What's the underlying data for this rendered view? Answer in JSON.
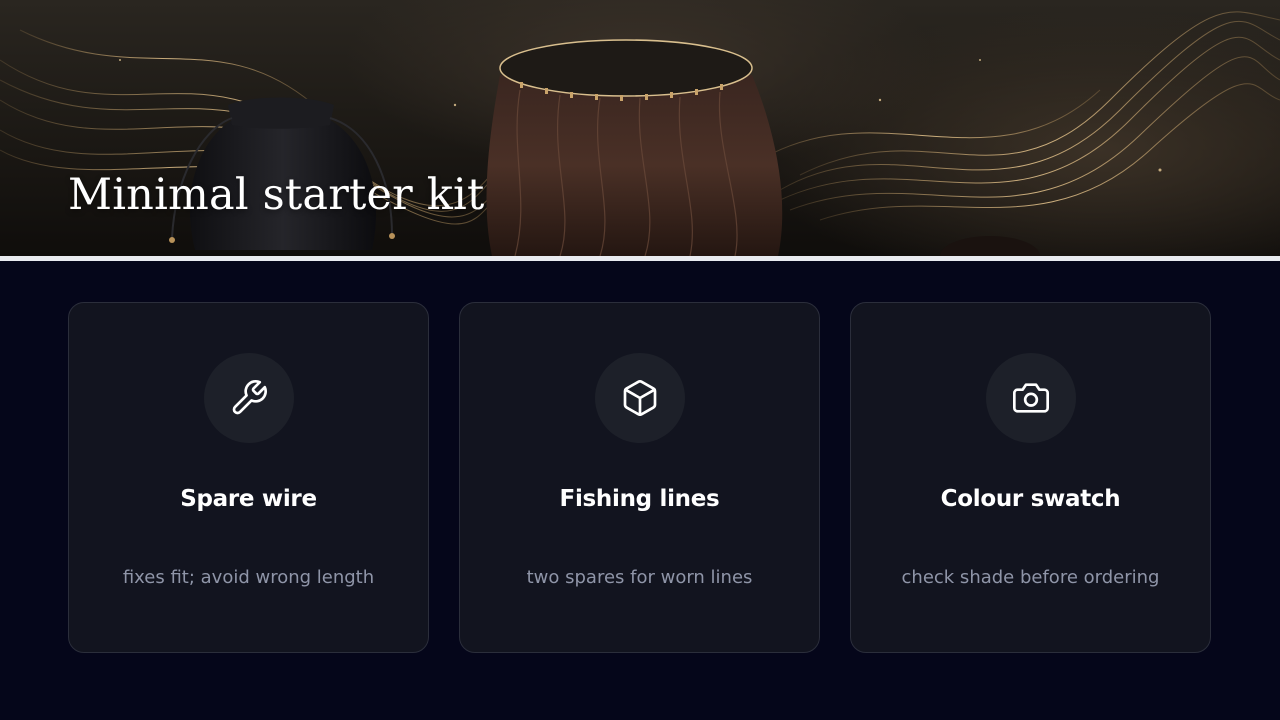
{
  "hero": {
    "title": "Minimal starter kit"
  },
  "cards": [
    {
      "icon": "wrench-icon",
      "title": "Spare wire",
      "description": "fixes fit; avoid wrong length"
    },
    {
      "icon": "box-icon",
      "title": "Fishing lines",
      "description": "two spares for worn lines"
    },
    {
      "icon": "camera-icon",
      "title": "Colour swatch",
      "description": "check shade before ordering"
    }
  ],
  "colors": {
    "background": "#05061a",
    "card": "#12141f",
    "accent_gold": "#c9a36a"
  }
}
